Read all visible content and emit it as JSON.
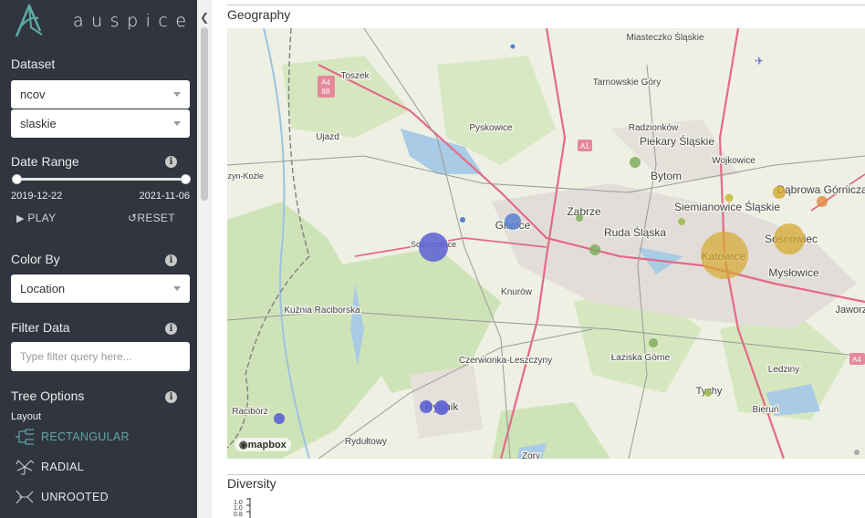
{
  "app": {
    "logo_text": "auspice"
  },
  "dataset": {
    "title": "Dataset",
    "select_1": "ncov",
    "select_2": "slaskie"
  },
  "date_range": {
    "title": "Date Range",
    "start": "2019-12-22",
    "end": "2021-11-06",
    "play_label": "PLAY",
    "reset_label": "RESET",
    "selected_fraction_start": 0.0,
    "selected_fraction_end": 1.0
  },
  "color_by": {
    "title": "Color By",
    "value": "Location"
  },
  "filter": {
    "title": "Filter Data",
    "placeholder": "Type filter query here..."
  },
  "tree_options": {
    "title": "Tree Options",
    "layout_label": "Layout",
    "layouts": [
      {
        "label": "RECTANGULAR",
        "active": true
      },
      {
        "label": "RADIAL",
        "active": false
      },
      {
        "label": "UNROOTED",
        "active": false
      }
    ]
  },
  "geography": {
    "title": "Geography",
    "map_attribution": "mapbox",
    "place_labels": [
      "Toszek",
      "Miasteczko Śląskie",
      "Tarnowskie Góry",
      "Radzionków",
      "Piekary Śląskie",
      "Wojkowice",
      "Bytom",
      "Zabrze",
      "Gliwice",
      "Ruda Śląska",
      "Siemianowice Śląskie",
      "Katowice",
      "Sosnowiec",
      "Dąbrowa Górnicza",
      "Mysłowice",
      "Sośnicowice",
      "Knurów",
      "Kuźnia Raciborska",
      "Czerwionka-Leszczyny",
      "Łaziska Górne",
      "Ledziny",
      "Tychy",
      "Bieruń",
      "Racibórz",
      "Rybnik",
      "Rydułtowy",
      "Ujazd",
      "Pyskowice",
      "Kędzierzyn-Koźle",
      "Jaworzno",
      "Zory"
    ],
    "road_labels": [
      "A4 88",
      "A1",
      "A4"
    ]
  },
  "diversity": {
    "title": "Diversity",
    "y_ticks": [
      "1.0",
      "1.0",
      "0.8"
    ]
  },
  "colors": {
    "sidebar_bg": "#30353f",
    "accent": "#5da8a3",
    "blue_marker": "#5b5fd4",
    "gold_marker": "#d6a82f",
    "green_marker": "#7cae5a"
  }
}
